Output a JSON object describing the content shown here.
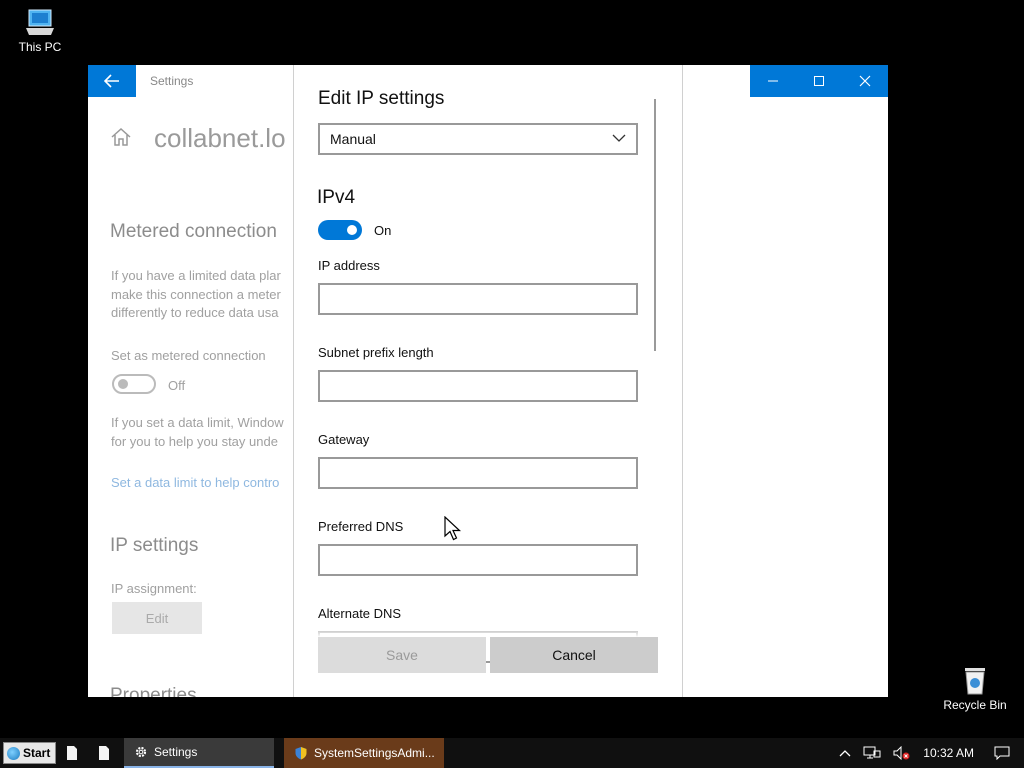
{
  "desktop": {
    "this_pc_label": "This PC",
    "recycle_bin_label": "Recycle Bin"
  },
  "settings_window": {
    "title": "Settings",
    "network_name": "collabnet.lo",
    "metered_heading": "Metered connection",
    "metered_desc": [
      "If you have a limited data plar",
      "make this connection a meter",
      "differently to reduce data usa"
    ],
    "set_metered_label": "Set as metered connection",
    "metered_toggle_state": "Off",
    "limit_desc": [
      "If you set a data limit, Window",
      "for you to help you stay unde"
    ],
    "limit_link": "Set a data limit to help contro",
    "ip_settings_heading": "IP settings",
    "ip_assignment_label": "IP assignment:",
    "edit_button": "Edit",
    "properties_heading": "Properties"
  },
  "dialog": {
    "title": "Edit IP settings",
    "mode_selected": "Manual",
    "ipv4_heading": "IPv4",
    "ipv4_toggle_state": "On",
    "fields": {
      "ip_address": {
        "label": "IP address",
        "value": ""
      },
      "subnet": {
        "label": "Subnet prefix length",
        "value": ""
      },
      "gateway": {
        "label": "Gateway",
        "value": ""
      },
      "preferred_dns": {
        "label": "Preferred DNS",
        "value": ""
      },
      "alternate_dns": {
        "label": "Alternate DNS",
        "value": ""
      }
    },
    "save_label": "Save",
    "cancel_label": "Cancel"
  },
  "taskbar": {
    "start_label": "Start",
    "apps": [
      {
        "label": "Settings"
      },
      {
        "label": "SystemSettingsAdmi..."
      }
    ],
    "clock": "10:32 AM"
  },
  "colors": {
    "accent": "#0078d7",
    "taskbar": "#101010"
  }
}
